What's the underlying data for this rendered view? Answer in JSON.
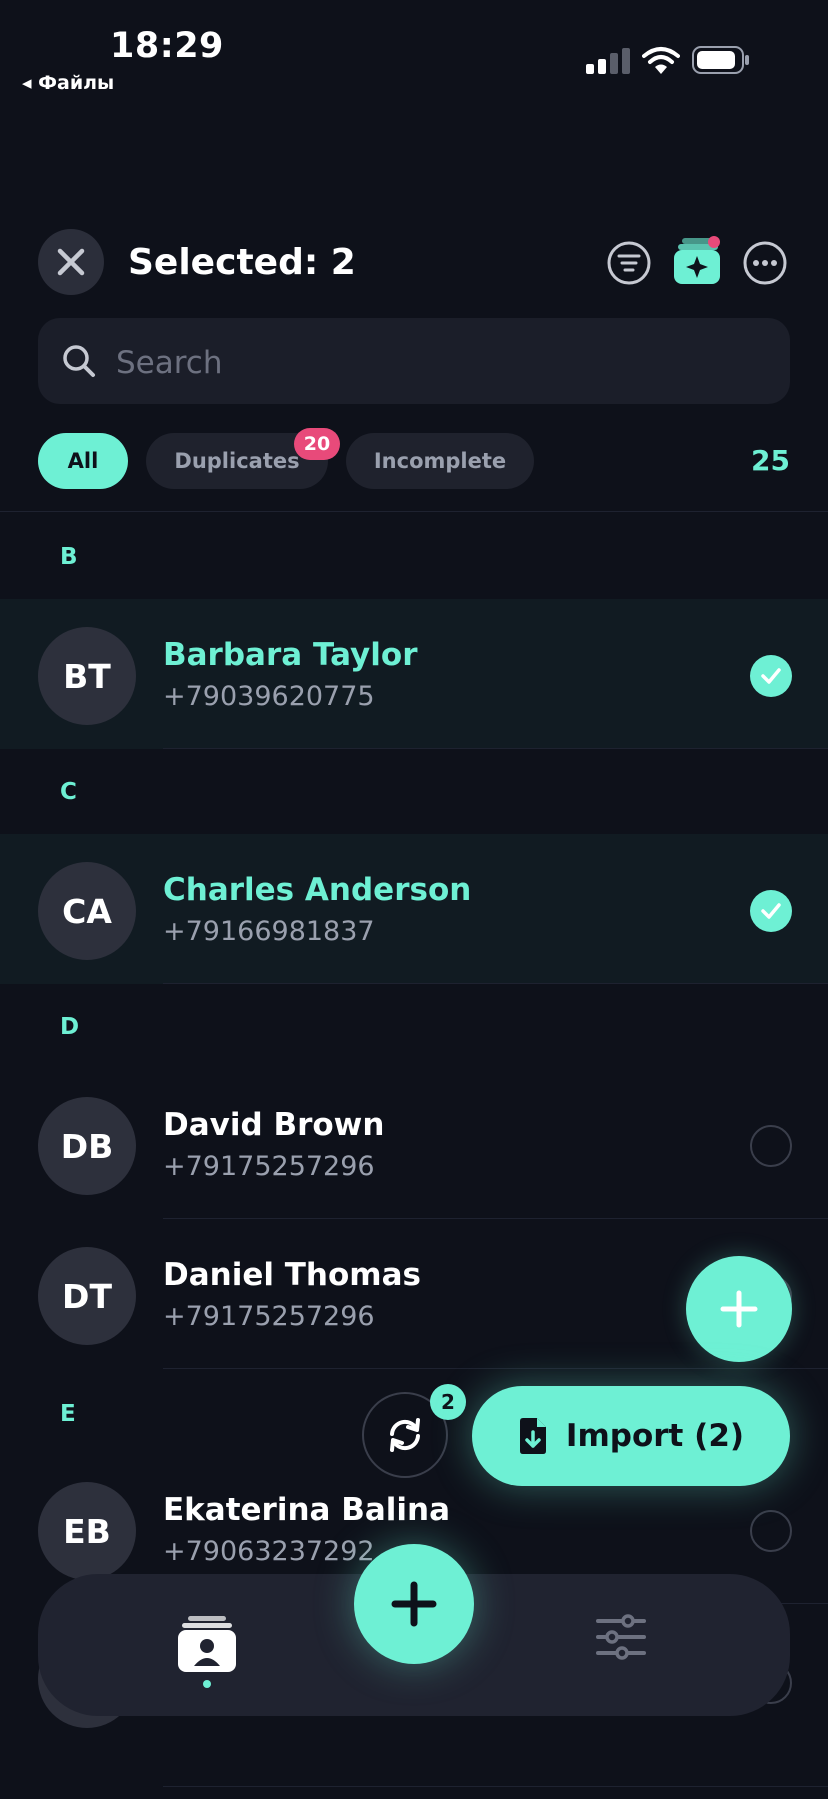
{
  "status_bar": {
    "time": "18:29",
    "back_app": "◂ Файлы"
  },
  "header": {
    "title": "Selected: 2"
  },
  "search": {
    "placeholder": "Search"
  },
  "filters": {
    "chips": [
      {
        "label": "All",
        "active": true
      },
      {
        "label": "Duplicates",
        "badge": "20"
      },
      {
        "label": "Incomplete"
      }
    ],
    "total": "25"
  },
  "sections": [
    {
      "letter": "B"
    },
    {
      "letter": "C"
    },
    {
      "letter": "D"
    },
    {
      "letter": "E"
    }
  ],
  "contacts": [
    {
      "initials": "BT",
      "name": "Barbara Taylor",
      "phone": "+79039620775",
      "selected": true
    },
    {
      "initials": "CA",
      "name": "Charles Anderson",
      "phone": "+79166981837",
      "selected": true
    },
    {
      "initials": "DB",
      "name": "David Brown",
      "phone": "+79175257296",
      "selected": false
    },
    {
      "initials": "DT",
      "name": "Daniel Thomas",
      "phone": "+79175257296",
      "selected": false
    },
    {
      "initials": "EB",
      "name": "Ekaterina Balina",
      "phone": "+79063237292",
      "selected": false
    }
  ],
  "actions": {
    "sync_badge": "2",
    "import_label": "Import (2)"
  },
  "colors": {
    "accent": "#6ef0d4",
    "background": "#0e111a",
    "badge": "#e84a7a"
  }
}
